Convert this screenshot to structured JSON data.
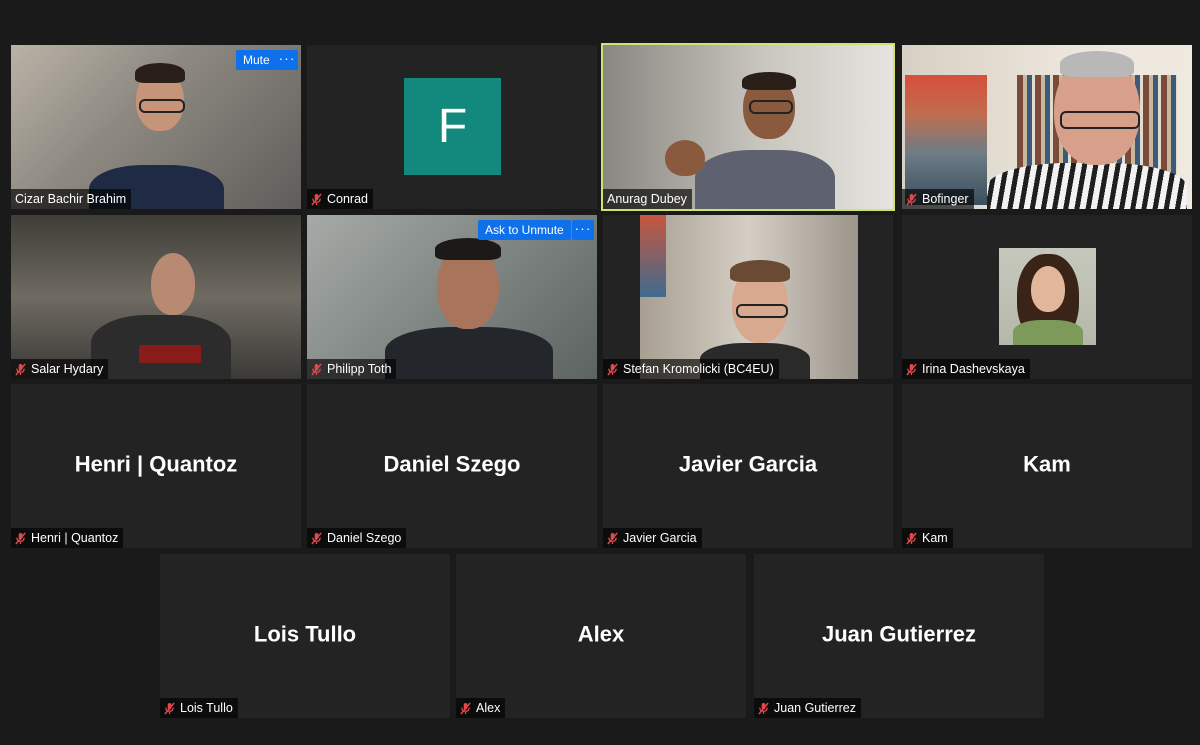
{
  "controls": {
    "mute_label": "Mute",
    "ask_unmute_label": "Ask to Unmute",
    "more_label": "···"
  },
  "avatar_letter": "F",
  "colors": {
    "active_speaker_border": "#cfe46e",
    "button_blue": "#0e71eb",
    "avatar_green": "#12897c",
    "muted_mic": "#e0494d"
  },
  "participants": [
    {
      "name": "Cizar Bachir Brahim",
      "muted": false,
      "type": "video"
    },
    {
      "name": "Conrad",
      "muted": true,
      "type": "avatar"
    },
    {
      "name": "Anurag Dubey",
      "muted": false,
      "type": "video",
      "active_speaker": true
    },
    {
      "name": "Bofinger",
      "muted": true,
      "type": "video"
    },
    {
      "name": "Salar Hydary",
      "muted": true,
      "type": "video"
    },
    {
      "name": "Philipp Toth",
      "muted": true,
      "type": "video"
    },
    {
      "name": "Stefan Kromolicki (BC4EU)",
      "muted": true,
      "type": "video"
    },
    {
      "name": "Irina Dashevskaya",
      "muted": true,
      "type": "photo"
    },
    {
      "name": "Henri | Quantoz",
      "muted": true,
      "type": "name"
    },
    {
      "name": "Daniel Szego",
      "muted": true,
      "type": "name"
    },
    {
      "name": "Javier Garcia",
      "muted": true,
      "type": "name"
    },
    {
      "name": "Kam",
      "muted": true,
      "type": "name"
    },
    {
      "name": "Lois Tullo",
      "muted": true,
      "type": "name"
    },
    {
      "name": "Alex",
      "muted": true,
      "type": "name"
    },
    {
      "name": "Juan Gutierrez",
      "muted": true,
      "type": "name"
    }
  ]
}
